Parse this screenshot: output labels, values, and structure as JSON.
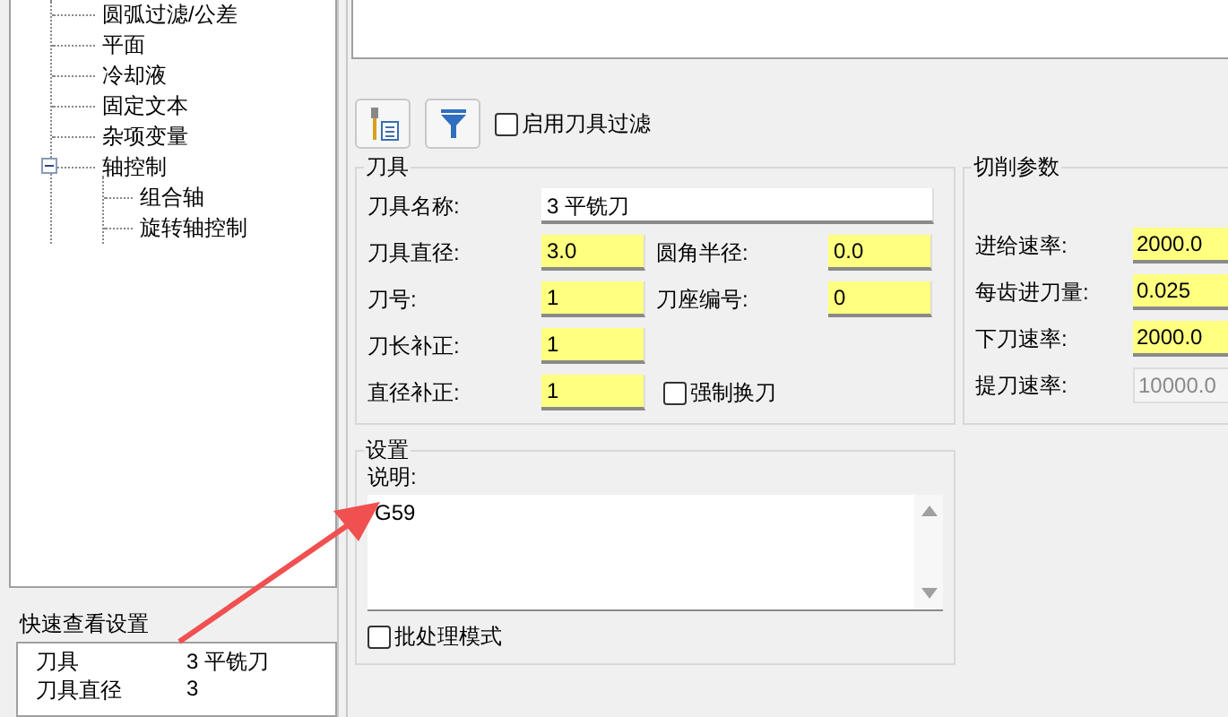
{
  "tree": {
    "items": [
      {
        "label": "圆弧过滤/公差"
      },
      {
        "label": "平面"
      },
      {
        "label": "冷却液"
      },
      {
        "label": "固定文本"
      },
      {
        "label": "杂项变量"
      },
      {
        "label": "轴控制",
        "expanded": true,
        "children": [
          {
            "label": "组合轴"
          },
          {
            "label": "旋转轴控制"
          }
        ]
      }
    ]
  },
  "quick_view": {
    "title": "快速查看设置",
    "rows": [
      {
        "name": "刀具",
        "value": "3 平铣刀"
      },
      {
        "name": "刀具直径",
        "value": "3"
      }
    ]
  },
  "toolbar": {
    "filter_checkbox": {
      "label": "启用刀具过滤",
      "checked": false
    }
  },
  "tool": {
    "title": "刀具",
    "rows": [
      [
        {
          "kind": "field",
          "label": "刀具名称:",
          "value": "3 平铣刀",
          "highlight": false,
          "wide": true
        }
      ],
      [
        {
          "kind": "field",
          "label": "刀具直径:",
          "value": "3.0",
          "highlight": true
        },
        {
          "kind": "field",
          "label": "圆角半径:",
          "value": "0.0",
          "highlight": true
        }
      ],
      [
        {
          "kind": "field",
          "label": "刀号:",
          "value": "1",
          "highlight": true
        },
        {
          "kind": "field",
          "label": "刀座编号:",
          "value": "0",
          "highlight": true
        }
      ],
      [
        {
          "kind": "field",
          "label": "刀长补正:",
          "value": "1",
          "highlight": true
        }
      ],
      [
        {
          "kind": "field",
          "label": "直径补正:",
          "value": "1",
          "highlight": true
        },
        {
          "kind": "checkbox",
          "label": "强制换刀",
          "checked": false
        }
      ]
    ]
  },
  "cutting": {
    "title": "切削参数",
    "fields": [
      {
        "label": "进给速率:",
        "value": "2000.0",
        "highlight": true,
        "disabled": false
      },
      {
        "label": "每齿进刀量:",
        "value": "0.025",
        "highlight": true,
        "disabled": false
      },
      {
        "label": "下刀速率:",
        "value": "2000.0",
        "highlight": true,
        "disabled": false
      },
      {
        "label": "提刀速率:",
        "value": "10000.0",
        "highlight": false,
        "disabled": true
      }
    ]
  },
  "settings": {
    "title": "设置",
    "description_label": "说明:",
    "description": "G59",
    "batch_checkbox": {
      "label": "批处理模式",
      "checked": false
    }
  }
}
